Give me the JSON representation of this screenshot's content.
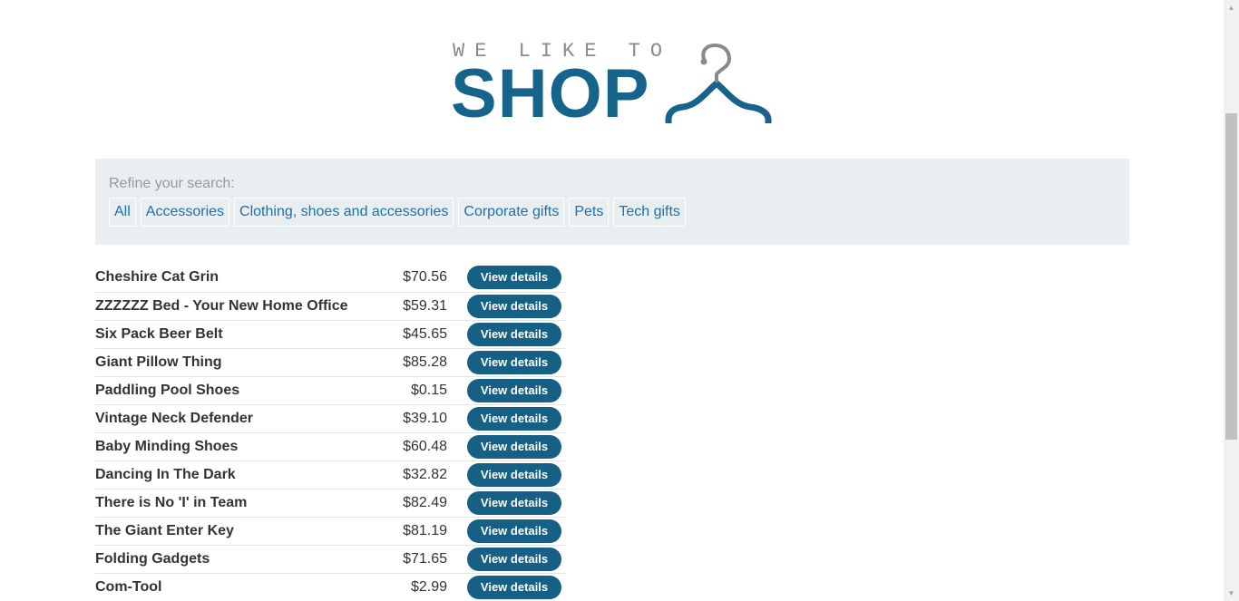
{
  "logo": {
    "tagline": "WE LIKE TO",
    "word": "SHOP"
  },
  "filters": {
    "label": "Refine your search:",
    "categories": [
      "All",
      "Accessories",
      "Clothing, shoes and accessories",
      "Corporate gifts",
      "Pets",
      "Tech gifts"
    ]
  },
  "products": [
    {
      "name": "Cheshire Cat Grin",
      "price": "$70.56",
      "action": "View details"
    },
    {
      "name": "ZZZZZZ Bed - Your New Home Office",
      "price": "$59.31",
      "action": "View details"
    },
    {
      "name": "Six Pack Beer Belt",
      "price": "$45.65",
      "action": "View details"
    },
    {
      "name": "Giant Pillow Thing",
      "price": "$85.28",
      "action": "View details"
    },
    {
      "name": "Paddling Pool Shoes",
      "price": "$0.15",
      "action": "View details"
    },
    {
      "name": "Vintage Neck Defender",
      "price": "$39.10",
      "action": "View details"
    },
    {
      "name": "Baby Minding Shoes",
      "price": "$60.48",
      "action": "View details"
    },
    {
      "name": "Dancing In The Dark",
      "price": "$32.82",
      "action": "View details"
    },
    {
      "name": "There is No 'I' in Team",
      "price": "$82.49",
      "action": "View details"
    },
    {
      "name": "The Giant Enter Key",
      "price": "$81.19",
      "action": "View details"
    },
    {
      "name": "Folding Gadgets",
      "price": "$71.65",
      "action": "View details"
    },
    {
      "name": "Com-Tool",
      "price": "$2.99",
      "action": "View details"
    }
  ],
  "icons": {
    "hanger": "hanger-icon",
    "scroll_up": "chevron-up-icon",
    "scroll_down": "chevron-down-icon"
  },
  "colors": {
    "brand": "#16648c",
    "button": "#165f85",
    "link": "#1c6fb0",
    "panel": "#e9eef1",
    "hanger_hook": "#8a8a8a"
  }
}
